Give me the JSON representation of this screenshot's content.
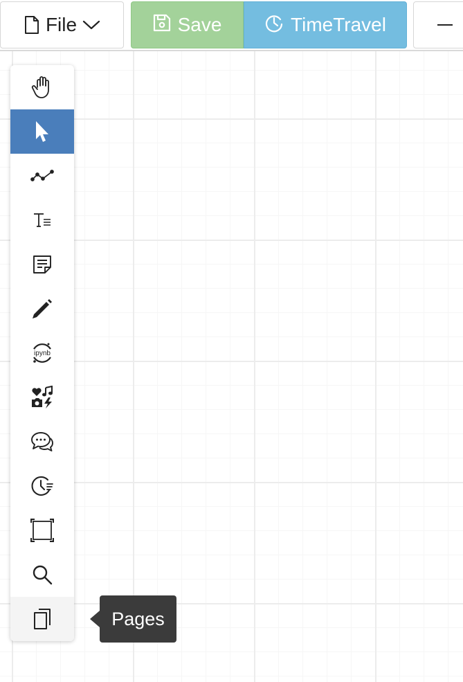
{
  "toolbar": {
    "file_label": "File",
    "save_label": "Save",
    "timetravel_label": "TimeTravel"
  },
  "colors": {
    "save_bg": "#a3d29a",
    "timetravel_bg": "#74bde0",
    "selected_tool_bg": "#4a7ebb",
    "tooltip_bg": "#3b3b3b"
  },
  "palette": {
    "tools": [
      {
        "icon": "hand-icon"
      },
      {
        "icon": "pointer-icon",
        "selected": true
      },
      {
        "icon": "connector-icon"
      },
      {
        "icon": "text-icon"
      },
      {
        "icon": "note-icon"
      },
      {
        "icon": "pencil-icon"
      },
      {
        "icon": "jupyter-icon",
        "label": "ipynb"
      },
      {
        "icon": "media-icon"
      },
      {
        "icon": "comment-icon"
      },
      {
        "icon": "history-icon"
      },
      {
        "icon": "frame-icon"
      },
      {
        "icon": "search-icon"
      },
      {
        "icon": "pages-icon",
        "hovered": true
      }
    ]
  },
  "tooltip": {
    "text": "Pages"
  }
}
